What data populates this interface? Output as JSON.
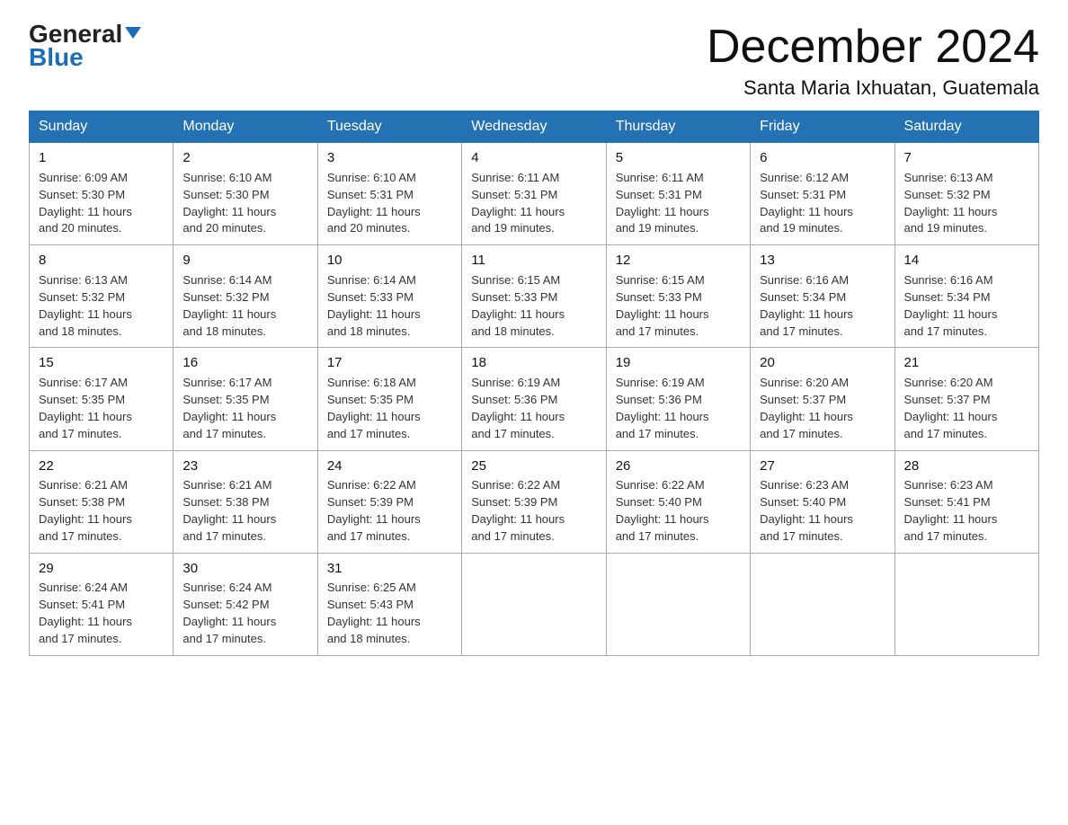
{
  "logo": {
    "text_general": "General",
    "text_blue": "Blue",
    "triangle_symbol": "▶"
  },
  "title": {
    "month": "December 2024",
    "location": "Santa Maria Ixhuatan, Guatemala"
  },
  "weekdays": [
    "Sunday",
    "Monday",
    "Tuesday",
    "Wednesday",
    "Thursday",
    "Friday",
    "Saturday"
  ],
  "weeks": [
    [
      {
        "day": "1",
        "sunrise": "6:09 AM",
        "sunset": "5:30 PM",
        "daylight": "11 hours and 20 minutes."
      },
      {
        "day": "2",
        "sunrise": "6:10 AM",
        "sunset": "5:30 PM",
        "daylight": "11 hours and 20 minutes."
      },
      {
        "day": "3",
        "sunrise": "6:10 AM",
        "sunset": "5:31 PM",
        "daylight": "11 hours and 20 minutes."
      },
      {
        "day": "4",
        "sunrise": "6:11 AM",
        "sunset": "5:31 PM",
        "daylight": "11 hours and 19 minutes."
      },
      {
        "day": "5",
        "sunrise": "6:11 AM",
        "sunset": "5:31 PM",
        "daylight": "11 hours and 19 minutes."
      },
      {
        "day": "6",
        "sunrise": "6:12 AM",
        "sunset": "5:31 PM",
        "daylight": "11 hours and 19 minutes."
      },
      {
        "day": "7",
        "sunrise": "6:13 AM",
        "sunset": "5:32 PM",
        "daylight": "11 hours and 19 minutes."
      }
    ],
    [
      {
        "day": "8",
        "sunrise": "6:13 AM",
        "sunset": "5:32 PM",
        "daylight": "11 hours and 18 minutes."
      },
      {
        "day": "9",
        "sunrise": "6:14 AM",
        "sunset": "5:32 PM",
        "daylight": "11 hours and 18 minutes."
      },
      {
        "day": "10",
        "sunrise": "6:14 AM",
        "sunset": "5:33 PM",
        "daylight": "11 hours and 18 minutes."
      },
      {
        "day": "11",
        "sunrise": "6:15 AM",
        "sunset": "5:33 PM",
        "daylight": "11 hours and 18 minutes."
      },
      {
        "day": "12",
        "sunrise": "6:15 AM",
        "sunset": "5:33 PM",
        "daylight": "11 hours and 17 minutes."
      },
      {
        "day": "13",
        "sunrise": "6:16 AM",
        "sunset": "5:34 PM",
        "daylight": "11 hours and 17 minutes."
      },
      {
        "day": "14",
        "sunrise": "6:16 AM",
        "sunset": "5:34 PM",
        "daylight": "11 hours and 17 minutes."
      }
    ],
    [
      {
        "day": "15",
        "sunrise": "6:17 AM",
        "sunset": "5:35 PM",
        "daylight": "11 hours and 17 minutes."
      },
      {
        "day": "16",
        "sunrise": "6:17 AM",
        "sunset": "5:35 PM",
        "daylight": "11 hours and 17 minutes."
      },
      {
        "day": "17",
        "sunrise": "6:18 AM",
        "sunset": "5:35 PM",
        "daylight": "11 hours and 17 minutes."
      },
      {
        "day": "18",
        "sunrise": "6:19 AM",
        "sunset": "5:36 PM",
        "daylight": "11 hours and 17 minutes."
      },
      {
        "day": "19",
        "sunrise": "6:19 AM",
        "sunset": "5:36 PM",
        "daylight": "11 hours and 17 minutes."
      },
      {
        "day": "20",
        "sunrise": "6:20 AM",
        "sunset": "5:37 PM",
        "daylight": "11 hours and 17 minutes."
      },
      {
        "day": "21",
        "sunrise": "6:20 AM",
        "sunset": "5:37 PM",
        "daylight": "11 hours and 17 minutes."
      }
    ],
    [
      {
        "day": "22",
        "sunrise": "6:21 AM",
        "sunset": "5:38 PM",
        "daylight": "11 hours and 17 minutes."
      },
      {
        "day": "23",
        "sunrise": "6:21 AM",
        "sunset": "5:38 PM",
        "daylight": "11 hours and 17 minutes."
      },
      {
        "day": "24",
        "sunrise": "6:22 AM",
        "sunset": "5:39 PM",
        "daylight": "11 hours and 17 minutes."
      },
      {
        "day": "25",
        "sunrise": "6:22 AM",
        "sunset": "5:39 PM",
        "daylight": "11 hours and 17 minutes."
      },
      {
        "day": "26",
        "sunrise": "6:22 AM",
        "sunset": "5:40 PM",
        "daylight": "11 hours and 17 minutes."
      },
      {
        "day": "27",
        "sunrise": "6:23 AM",
        "sunset": "5:40 PM",
        "daylight": "11 hours and 17 minutes."
      },
      {
        "day": "28",
        "sunrise": "6:23 AM",
        "sunset": "5:41 PM",
        "daylight": "11 hours and 17 minutes."
      }
    ],
    [
      {
        "day": "29",
        "sunrise": "6:24 AM",
        "sunset": "5:41 PM",
        "daylight": "11 hours and 17 minutes."
      },
      {
        "day": "30",
        "sunrise": "6:24 AM",
        "sunset": "5:42 PM",
        "daylight": "11 hours and 17 minutes."
      },
      {
        "day": "31",
        "sunrise": "6:25 AM",
        "sunset": "5:43 PM",
        "daylight": "11 hours and 18 minutes."
      },
      null,
      null,
      null,
      null
    ]
  ],
  "labels": {
    "sunrise": "Sunrise:",
    "sunset": "Sunset:",
    "daylight": "Daylight:"
  }
}
